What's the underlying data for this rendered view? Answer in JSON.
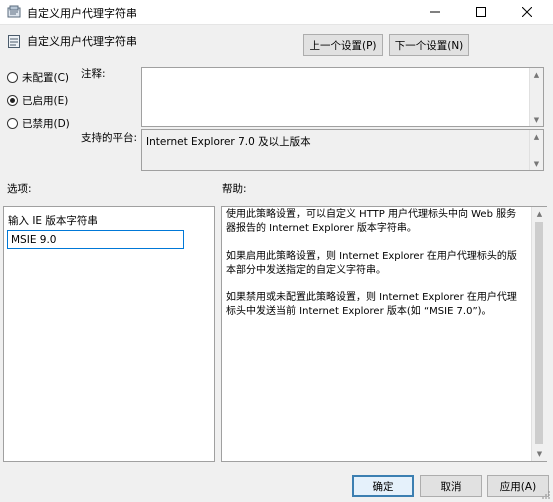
{
  "window": {
    "title": "自定义用户代理字符串",
    "minimize_icon": "minimize-icon",
    "maximize_icon": "maximize-icon",
    "close_icon": "close-icon"
  },
  "header": {
    "title": "自定义用户代理字符串",
    "icon": "policy-setting-icon",
    "prev_label": "上一个设置(P)",
    "next_label": "下一个设置(N)"
  },
  "state": {
    "options": [
      {
        "label": "未配置(C)",
        "selected": false
      },
      {
        "label": "已启用(E)",
        "selected": true
      },
      {
        "label": "已禁用(D)",
        "selected": false
      }
    ]
  },
  "comment": {
    "label": "注释:",
    "value": ""
  },
  "platform": {
    "label": "支持的平台:",
    "value": "Internet Explorer 7.0 及以上版本"
  },
  "options_pane": {
    "label": "选项:",
    "field_label": "输入 IE 版本字符串",
    "field_value": "MSIE 9.0"
  },
  "help_pane": {
    "label": "帮助:",
    "paragraphs": [
      "使用此策略设置，可以自定义 HTTP 用户代理标头中向 Web 服务器报告的 Internet Explorer 版本字符串。",
      "如果启用此策略设置，则 Internet Explorer 在用户代理标头的版本部分中发送指定的自定义字符串。",
      "如果禁用或未配置此策略设置，则 Internet Explorer 在用户代理标头中发送当前 Internet Explorer 版本(如 “MSIE 7.0”)。"
    ]
  },
  "footer": {
    "ok_label": "确定",
    "cancel_label": "取消",
    "apply_label": "应用(A)"
  },
  "colors": {
    "dialog_bg": "#f0f0f0",
    "focus_border": "#0078d7",
    "default_button_border": "#3c7fb1"
  }
}
